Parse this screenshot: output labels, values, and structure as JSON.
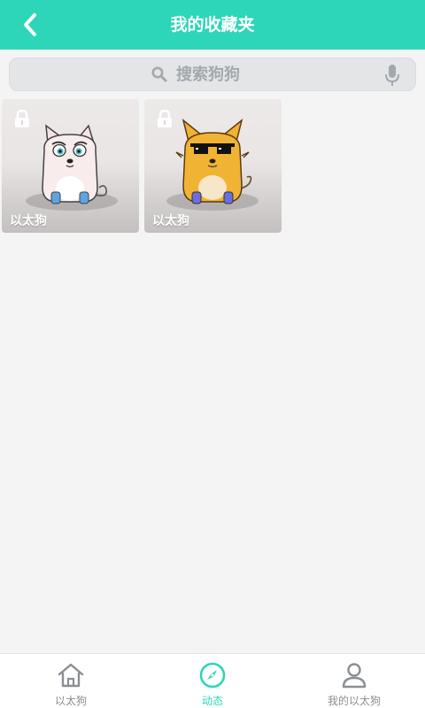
{
  "header": {
    "title": "我的收藏夹",
    "back_icon": "chevron-left-icon"
  },
  "search": {
    "placeholder": "搜索狗狗",
    "icons": [
      "search-icon",
      "microphone-icon"
    ]
  },
  "cards": [
    {
      "label": "以太狗",
      "locked": true,
      "variant": "white-dog"
    },
    {
      "label": "以太狗",
      "locked": true,
      "variant": "yellow-dog-sunglasses"
    }
  ],
  "tabs": [
    {
      "label": "以太狗",
      "icon": "home-icon",
      "active": false
    },
    {
      "label": "动态",
      "icon": "compass-icon",
      "active": true
    },
    {
      "label": "我的以太狗",
      "icon": "user-icon",
      "active": false
    }
  ],
  "colors": {
    "accent": "#2dd6b8",
    "background": "#f4f4f4",
    "inactive": "#8a8f93"
  }
}
